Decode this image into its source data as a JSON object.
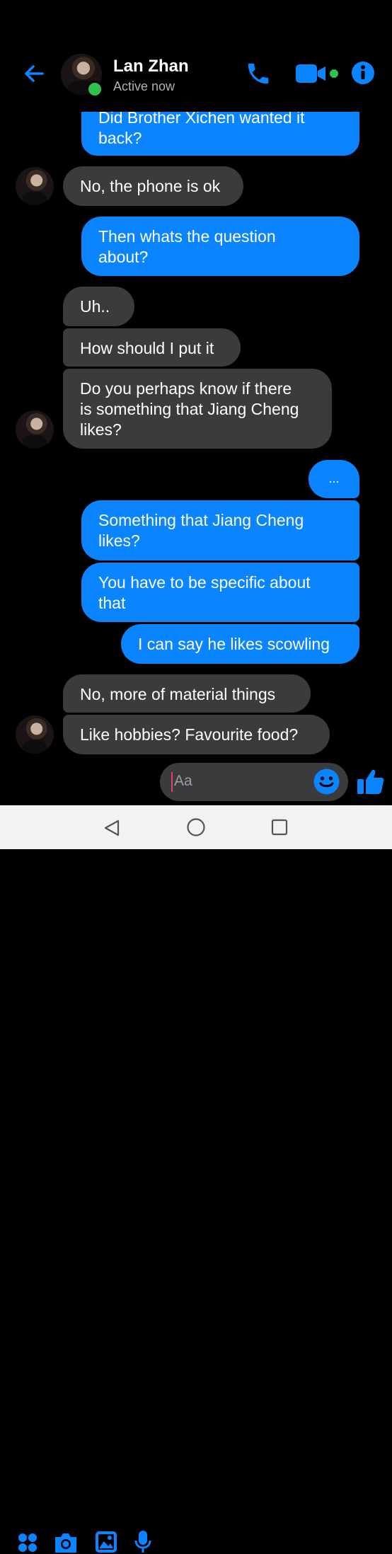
{
  "header": {
    "name": "Lan Zhan",
    "status": "Active now",
    "icons": [
      "back-arrow-icon",
      "phone-icon",
      "video-camera-icon",
      "info-icon"
    ],
    "accent": "#0b84ff",
    "online_color": "#31c24d"
  },
  "messages": [
    {
      "dir": "out",
      "text": "Did Brother Xichen wanted it\nback?"
    },
    {
      "dir": "in",
      "text": "No, the phone is ok"
    },
    {
      "dir": "out",
      "text": "Then whats the question\nabout?"
    },
    {
      "dir": "in",
      "text": "Uh.."
    },
    {
      "dir": "in",
      "text": "How should I put it"
    },
    {
      "dir": "in",
      "text": "Do you perhaps know if there\nis something that Jiang Cheng\nlikes?"
    },
    {
      "dir": "out",
      "text": "..."
    },
    {
      "dir": "out",
      "text": "Something that Jiang Cheng\nlikes?"
    },
    {
      "dir": "out",
      "text": "You have to be specific about\nthat"
    },
    {
      "dir": "out",
      "text": "I can say he likes scowling"
    },
    {
      "dir": "in",
      "text": "No, more of material things"
    },
    {
      "dir": "in",
      "text": "Like hobbies? Favourite food?"
    }
  ],
  "composer": {
    "placeholder": "Aa",
    "icons": [
      "menu-dots-icon",
      "camera-icon",
      "gallery-icon",
      "microphone-icon",
      "emoji-icon",
      "thumbs-up-icon"
    ]
  },
  "navbar": {
    "icons": [
      "back-triangle-icon",
      "home-circle-icon",
      "recents-square-icon"
    ]
  }
}
